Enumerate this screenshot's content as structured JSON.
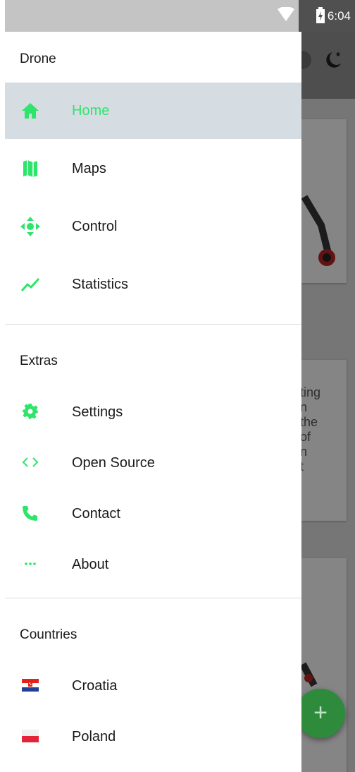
{
  "status": {
    "time": "6:04"
  },
  "drawer": {
    "sections": [
      {
        "header": "Drone",
        "items": [
          {
            "label": "Home",
            "icon": "home-icon"
          },
          {
            "label": "Maps",
            "icon": "map-icon"
          },
          {
            "label": "Control",
            "icon": "move-arrows-icon"
          },
          {
            "label": "Statistics",
            "icon": "trend-line-icon"
          }
        ]
      },
      {
        "header": "Extras",
        "items": [
          {
            "label": "Settings",
            "icon": "gear-icon"
          },
          {
            "label": "Open Source",
            "icon": "code-brackets-icon"
          },
          {
            "label": "Contact",
            "icon": "phone-icon"
          },
          {
            "label": "About",
            "icon": "ellipsis-icon"
          }
        ]
      },
      {
        "header": "Countries",
        "items": [
          {
            "label": "Croatia",
            "icon": "croatia-flag-icon"
          },
          {
            "label": "Poland",
            "icon": "poland-flag-icon"
          }
        ]
      }
    ]
  },
  "background": {
    "card_text": "ting\nn\nthe\nof\nn\nt"
  },
  "fab": {
    "label": "+"
  },
  "colors": {
    "accent": "#2ee56b",
    "active_bg": "#d5dde2",
    "status_bar": "#c4c4c4"
  }
}
